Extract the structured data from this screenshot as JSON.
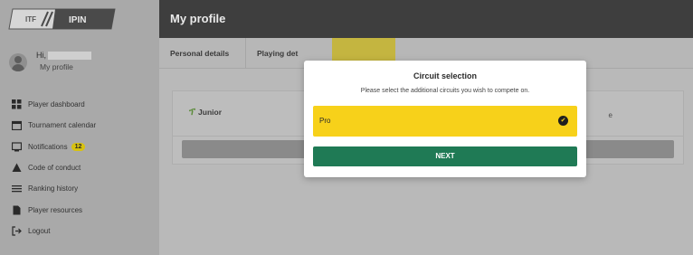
{
  "sidebar": {
    "logo": {
      "brand_text": "IPIN",
      "mark_text": "ITF"
    },
    "user": {
      "greeting": "Hi,",
      "profile_link": "My profile"
    },
    "items": [
      {
        "label": "Player dashboard",
        "icon": "dashboard-icon"
      },
      {
        "label": "Tournament calendar",
        "icon": "calendar-icon"
      },
      {
        "label": "Notifications",
        "icon": "notifications-icon",
        "badge": "12"
      },
      {
        "label": "Code of conduct",
        "icon": "warning-icon"
      },
      {
        "label": "Ranking history",
        "icon": "list-icon"
      },
      {
        "label": "Player resources",
        "icon": "document-icon"
      },
      {
        "label": "Logout",
        "icon": "logout-icon"
      }
    ]
  },
  "header": {
    "title": "My profile"
  },
  "tabs": [
    {
      "label": "Personal details"
    },
    {
      "label": "Playing det"
    }
  ],
  "card": {
    "circuit_label": "Junior",
    "right_tag": "e"
  },
  "modal": {
    "title": "Circuit selection",
    "subtitle": "Please select the additional circuits you wish to compete on.",
    "option_label": "Pro",
    "next_label": "NEXT"
  },
  "colors": {
    "option_bg": "#f7d11a",
    "next_bg": "#1f7a55",
    "header_bg": "#3e3e3e",
    "badge_bg": "#d8c20f"
  }
}
